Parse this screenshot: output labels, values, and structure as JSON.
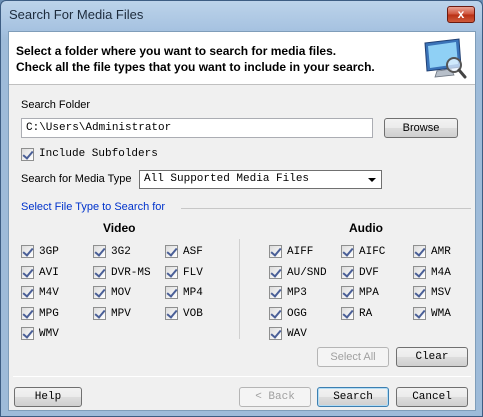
{
  "window": {
    "title": "Search For Media Files",
    "close_glyph": "x"
  },
  "header": {
    "line1": "Select a folder where you want to search for media files.",
    "line2": "Check all the file types that you want to include in your search.",
    "icon": "monitor-magnifier-icon"
  },
  "folder": {
    "label": "Search Folder",
    "value": "C:\\Users\\Administrator",
    "browse_label": "Browse"
  },
  "include_subfolders": {
    "label": "Include Subfolders",
    "checked": true
  },
  "media_type": {
    "label": "Search for Media Type",
    "selected": "All Supported Media Files"
  },
  "file_types": {
    "section_title": "Select File Type to Search for",
    "video": {
      "heading": "Video",
      "items": [
        "3GP",
        "3G2",
        "ASF",
        "AVI",
        "DVR-MS",
        "FLV",
        "M4V",
        "MOV",
        "MP4",
        "MPG",
        "MPV",
        "VOB",
        "WMV"
      ]
    },
    "audio": {
      "heading": "Audio",
      "items": [
        "AIFF",
        "AIFC",
        "AMR",
        "AU/SND",
        "DVF",
        "M4A",
        "MP3",
        "MPA",
        "MSV",
        "OGG",
        "RA",
        "WMA",
        "WAV"
      ]
    },
    "select_all_label": "Select All",
    "clear_label": "Clear"
  },
  "footer": {
    "help_label": "Help",
    "back_label": "< Back",
    "search_label": "Search",
    "cancel_label": "Cancel"
  }
}
